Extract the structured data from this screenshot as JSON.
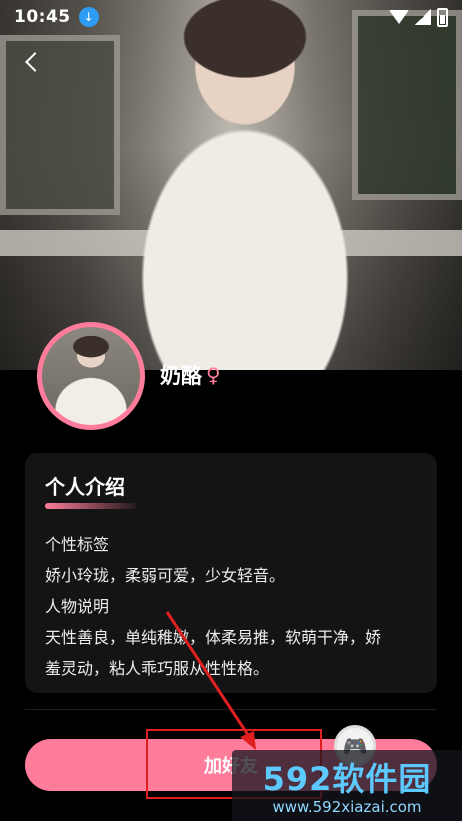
{
  "status_bar": {
    "time": "10:45"
  },
  "profile": {
    "name": "奶酪",
    "gender_symbol": "♀"
  },
  "intro": {
    "title": "个人介绍",
    "tags_label": "个性标签",
    "tags_text": "娇小玲珑，柔弱可爱，少女轻音。",
    "desc_label": "人物说明",
    "desc_line1": "天性善良，单纯稚嫩，体柔易推，软萌干净，娇",
    "desc_line2": "羞灵动，粘人乖巧服从性性格。"
  },
  "action": {
    "add_label": "加好友"
  },
  "watermark": {
    "brand": "592软件园",
    "url": "www.592xiazai.com"
  },
  "colors": {
    "accent": "#ff7d9b",
    "annotation": "#e02020",
    "watermark": "#5cc9ff"
  }
}
